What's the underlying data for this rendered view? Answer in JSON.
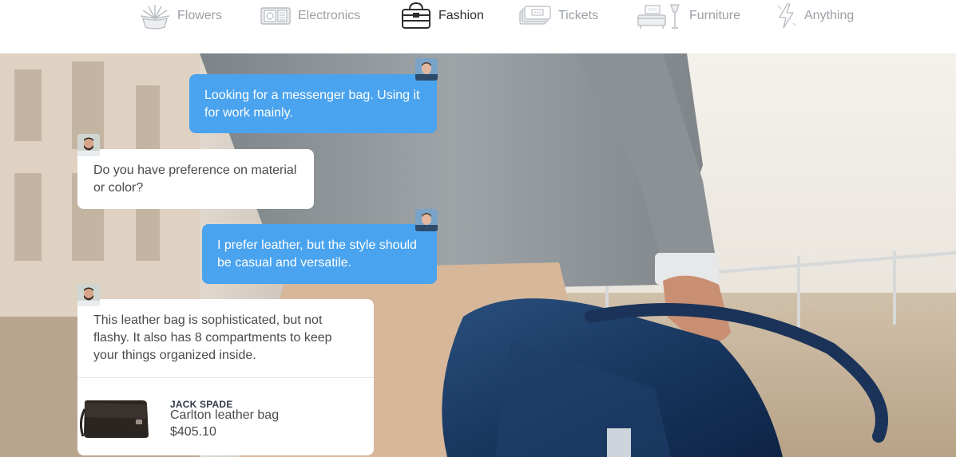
{
  "nav": {
    "items": [
      {
        "label": "Flowers",
        "icon": "flowers-icon",
        "active": false
      },
      {
        "label": "Electronics",
        "icon": "electronics-icon",
        "active": false
      },
      {
        "label": "Fashion",
        "icon": "fashion-bag-icon",
        "active": true
      },
      {
        "label": "Tickets",
        "icon": "tickets-icon",
        "active": false
      },
      {
        "label": "Furniture",
        "icon": "furniture-icon",
        "active": false
      },
      {
        "label": "Anything",
        "icon": "lightning-icon",
        "active": false
      }
    ],
    "colors": {
      "active": "#2d2d2d",
      "inactive": "#9aa0a6"
    }
  },
  "chat": {
    "colors": {
      "user_bubble": "#4aa3ee",
      "agent_bubble": "#ffffff"
    },
    "messages": [
      {
        "from": "user",
        "text": "Looking for a messenger bag. Using it for work mainly."
      },
      {
        "from": "agent",
        "text": "Do you have preference on material or color?"
      },
      {
        "from": "user",
        "text": "I prefer leather, but the style should be casual and versatile."
      },
      {
        "from": "agent",
        "text": "This leather bag is sophisticated, but not flashy. It also has 8 compartments to keep your things organized inside."
      }
    ],
    "product": {
      "brand": "JACK SPADE",
      "name": "Carlton leather bag",
      "price": "$405.10"
    }
  }
}
